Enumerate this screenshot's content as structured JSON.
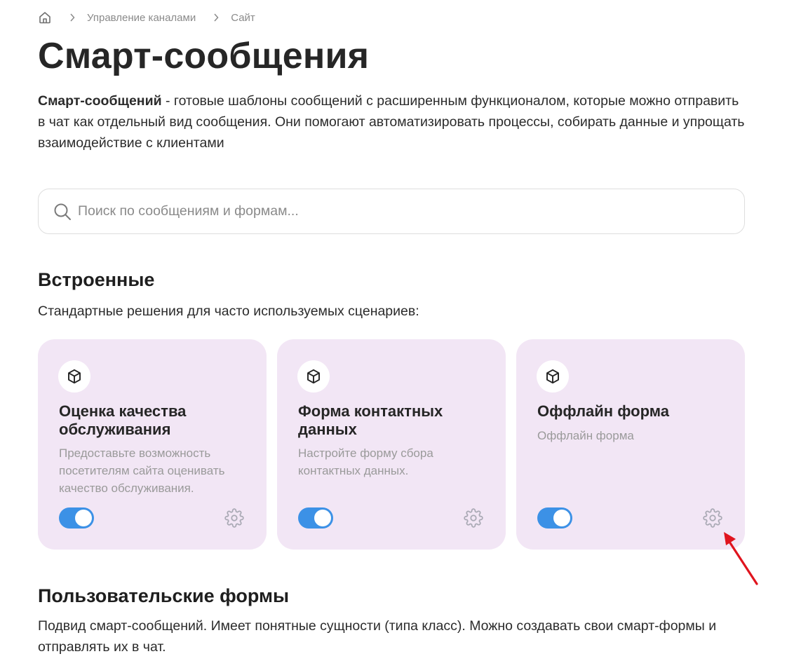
{
  "breadcrumb": {
    "home_icon": "home-icon",
    "items": [
      "Управление каналами",
      "Сайт"
    ]
  },
  "page": {
    "title": "Смарт-сообщения",
    "intro_bold": "Смарт-сообщений",
    "intro_rest": " - готовые шаблоны сообщений с расширенным функционалом, которые можно отправить в чат как отдельный вид сообщения. Они помогают автоматизировать процессы, собирать данные и упрощать взаимодействие с клиентами"
  },
  "search": {
    "placeholder": "Поиск по сообщениям и формам...",
    "value": "",
    "icon": "search-icon"
  },
  "builtin": {
    "title": "Встроенные",
    "description": "Стандартные решения для часто используемых сценариев:",
    "cards": [
      {
        "title": "Оценка качества обслуживания",
        "description": "Предоставьте возможность посетителям сайта оценивать качество обслуживания.",
        "enabled": true,
        "icon": "cube-icon"
      },
      {
        "title": "Форма контактных данных",
        "description": "Настройте форму сбора контактных данных.",
        "enabled": true,
        "icon": "cube-icon"
      },
      {
        "title": "Оффлайн форма",
        "description": "Оффлайн форма",
        "enabled": true,
        "icon": "cube-icon"
      }
    ]
  },
  "custom": {
    "title": "Пользовательские формы",
    "description": "Подвид смарт-сообщений. Имеет понятные сущности (типа класс). Можно создавать свои смарт-формы и отправлять их в чат."
  },
  "colors": {
    "card_background": "#f2e6f5",
    "toggle_on": "#3c91e6",
    "annotation_arrow": "#e0141e"
  }
}
